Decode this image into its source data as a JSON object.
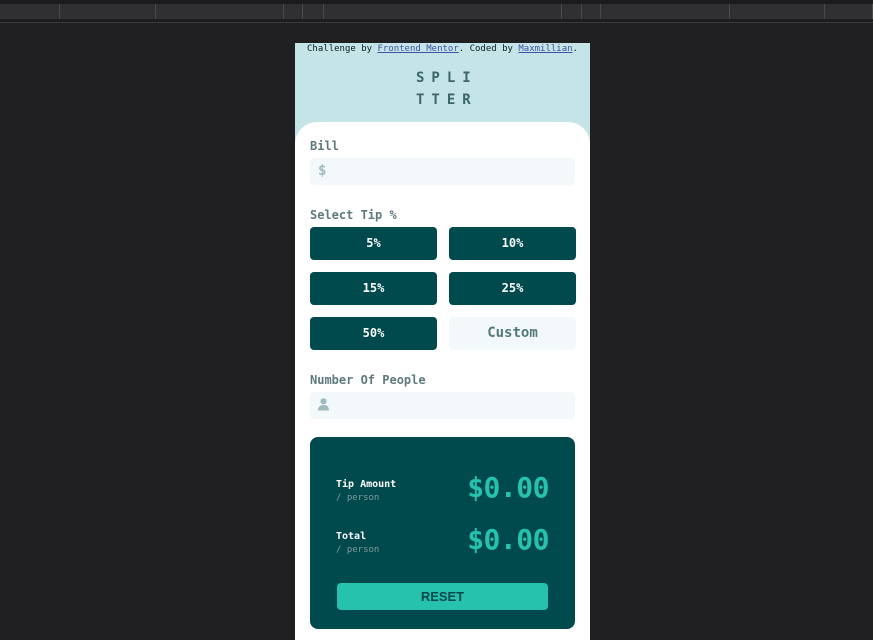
{
  "attribution": {
    "prefix": "Challenge by ",
    "link1": "Frontend Mentor",
    "middle": ". Coded by ",
    "link2": "Maxmillian",
    "suffix": "."
  },
  "logo": {
    "line1": "SPLI",
    "line2": "TTER"
  },
  "bill": {
    "label": "Bill",
    "icon": "$",
    "value": ""
  },
  "tip": {
    "label": "Select Tip %",
    "options": [
      "5%",
      "10%",
      "15%",
      "25%",
      "50%"
    ],
    "custom_placeholder": "Custom"
  },
  "people": {
    "label": "Number Of People",
    "icon_name": "person-icon",
    "value": ""
  },
  "results": {
    "tip_amount": {
      "label": "Tip Amount",
      "sub": "/ person",
      "value": "$0.00"
    },
    "total": {
      "label": "Total",
      "sub": "/ person",
      "value": "$0.00"
    },
    "reset_label": "RESET"
  },
  "colors": {
    "page_bg": "#c5e4e7",
    "dark_cyan": "#00494d",
    "strong_cyan": "#26c2ae",
    "input_bg": "#f3f9fa"
  }
}
